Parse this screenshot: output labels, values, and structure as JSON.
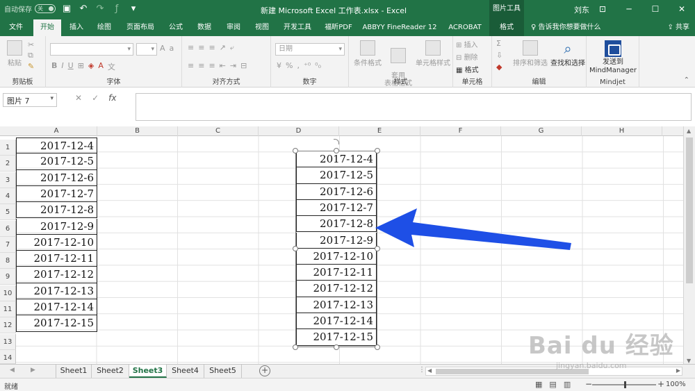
{
  "titlebar": {
    "autosave_label": "自动保存",
    "autosave_state": "关",
    "title": "新建 Microsoft Excel 工作表.xlsx  -  Excel",
    "context_tool": "图片工具",
    "user": "刘东"
  },
  "tabs": [
    {
      "label": "文件"
    },
    {
      "label": "开始"
    },
    {
      "label": "插入"
    },
    {
      "label": "绘图"
    },
    {
      "label": "页面布局"
    },
    {
      "label": "公式"
    },
    {
      "label": "数据"
    },
    {
      "label": "审阅"
    },
    {
      "label": "视图"
    },
    {
      "label": "开发工具"
    },
    {
      "label": "福昕PDF"
    },
    {
      "label": "ABBYY FineReader 12"
    },
    {
      "label": "ACROBAT"
    },
    {
      "label": "格式"
    }
  ],
  "tellme": "告诉我你想要做什么",
  "share": "共享",
  "ribbon": {
    "clipboard": {
      "paste": "粘贴",
      "label": "剪贴板"
    },
    "font": {
      "label": "字体"
    },
    "alignment": {
      "label": "对齐方式"
    },
    "number": {
      "format": "日期",
      "label": "数字"
    },
    "styles": {
      "conditional": "条件格式",
      "table": "套用\n表格格式",
      "cell": "单元格样式",
      "label": "样式"
    },
    "cells": {
      "insert": "插入",
      "delete": "删除",
      "format": "格式",
      "label": "单元格"
    },
    "editing": {
      "sort": "排序和筛选",
      "find": "查找和选择",
      "label": "编辑"
    },
    "mindjet": {
      "send1": "发送到",
      "send2": "MindManager",
      "label": "Mindjet"
    }
  },
  "formula_bar": {
    "name_box": "图片 7",
    "fx": "fx",
    "value": ""
  },
  "columns": [
    "A",
    "B",
    "C",
    "D",
    "E",
    "F",
    "G",
    "H"
  ],
  "rows": [
    "1",
    "2",
    "3",
    "4",
    "5",
    "6",
    "7",
    "8",
    "9",
    "10",
    "11",
    "12",
    "13",
    "14"
  ],
  "column_a": [
    "2017-12-4",
    "2017-12-5",
    "2017-12-6",
    "2017-12-7",
    "2017-12-8",
    "2017-12-9",
    "2017-12-10",
    "2017-12-11",
    "2017-12-12",
    "2017-12-13",
    "2017-12-14",
    "2017-12-15"
  ],
  "picture_values": [
    "2017-12-4",
    "2017-12-5",
    "2017-12-6",
    "2017-12-7",
    "2017-12-8",
    "2017-12-9",
    "2017-12-10",
    "2017-12-11",
    "2017-12-12",
    "2017-12-13",
    "2017-12-14",
    "2017-12-15"
  ],
  "sheets": [
    {
      "name": "Sheet1"
    },
    {
      "name": "Sheet2"
    },
    {
      "name": "Sheet3"
    },
    {
      "name": "Sheet4"
    },
    {
      "name": "Sheet5"
    }
  ],
  "active_sheet": "Sheet3",
  "status": {
    "ready": "就绪",
    "zoom": "100%"
  },
  "colors": {
    "excel_green": "#217346",
    "arrow_blue": "#1e4fe6"
  },
  "watermark": {
    "brand": "Bai du 经验",
    "url": "jingyan.baidu.com"
  }
}
